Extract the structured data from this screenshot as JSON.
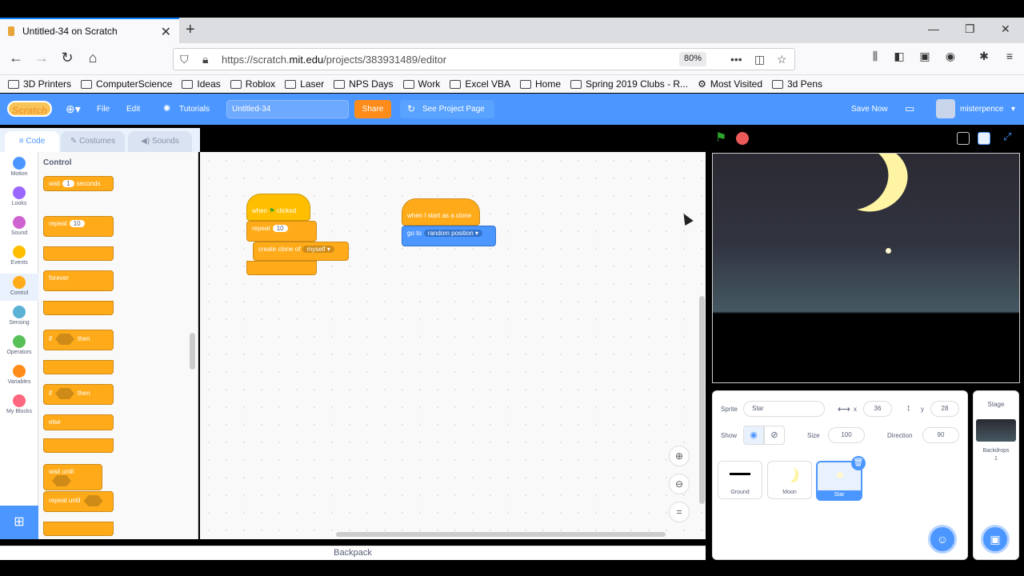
{
  "browser": {
    "tab_title": "Untitled-34 on Scratch",
    "tab_close": "✕",
    "new_tab": "+",
    "url_prefix": "https://scratch.",
    "url_domain": "mit.edu",
    "url_suffix": "/projects/383931489/editor",
    "zoom": "80%",
    "bookmarks": [
      "3D Printers",
      "ComputerScience",
      "Ideas",
      "Roblox",
      "Laser",
      "NPS Days",
      "Work",
      "Excel VBA",
      "Home",
      "Spring 2019 Clubs - R...",
      "Most Visited",
      "3d Pens"
    ]
  },
  "scratch": {
    "logo": "Scratch",
    "menu": {
      "file": "File",
      "edit": "Edit",
      "tutorials": "Tutorials"
    },
    "project_title": "Untitled-34",
    "share": "Share",
    "see_project": "See Project Page",
    "save_now": "Save Now",
    "username": "misterpence",
    "tabs": {
      "code": "Code",
      "costumes": "Costumes",
      "sounds": "Sounds"
    },
    "categories": [
      "Motion",
      "Looks",
      "Sound",
      "Events",
      "Control",
      "Sensing",
      "Operators",
      "Variables",
      "My Blocks"
    ],
    "category_colors": [
      "#4c97ff",
      "#9966ff",
      "#cf63cf",
      "#ffbf00",
      "#ffab19",
      "#5cb1d6",
      "#59c059",
      "#ff8c1a",
      "#ff6680"
    ],
    "flyout": {
      "section": "Control",
      "wait": "wait",
      "wait_val": "1",
      "seconds": "seconds",
      "repeat": "repeat",
      "repeat_val": "10",
      "forever": "forever",
      "if": "if",
      "then": "then",
      "else": "else",
      "wait_until": "wait until",
      "repeat_until": "repeat until"
    },
    "script1": {
      "when": "when",
      "clicked": "clicked",
      "repeat": "repeat",
      "repeat_val": "10",
      "create_clone": "create clone of",
      "clone_target": "myself ▾"
    },
    "script2": {
      "hat": "when I start as a clone",
      "goto": "go to",
      "goto_target": "random position ▾"
    },
    "backpack": "Backpack",
    "sprite_info": {
      "sprite_label": "Sprite",
      "sprite_name": "Star",
      "x_label": "x",
      "x": "36",
      "y_label": "y",
      "y": "28",
      "show_label": "Show",
      "size_label": "Size",
      "size": "100",
      "direction_label": "Direction",
      "direction": "90"
    },
    "sprites": [
      "Ground",
      "Moon",
      "Star"
    ],
    "stage_panel": {
      "title": "Stage",
      "backdrops_label": "Backdrops",
      "backdrops_count": "1"
    }
  }
}
